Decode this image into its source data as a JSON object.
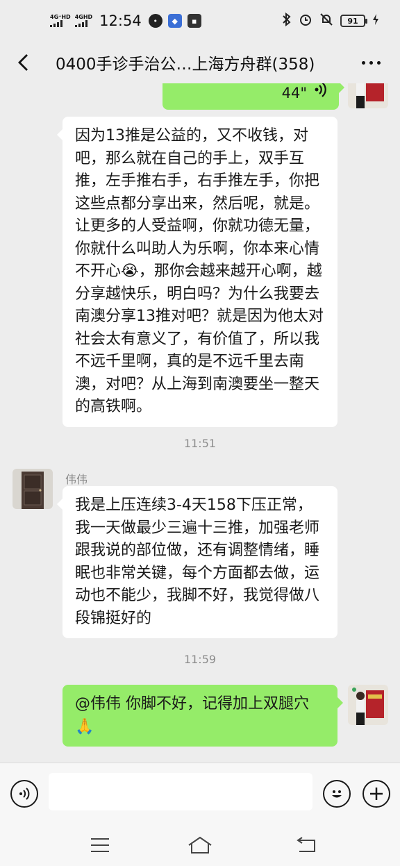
{
  "status": {
    "sig1": "4G⁺HD",
    "sig2": "4GHD",
    "time": "12:54",
    "battery": "91"
  },
  "header": {
    "title": "0400手诊手治公…上海方舟群(358)"
  },
  "messages": {
    "voice_duration": "44\"",
    "msg1_text": "因为13推是公益的，又不收钱，对吧，那么就在自己的手上，双手互推，左手推右手，右手推左手，你把这些点都分享出来，然后呢，就是。让更多的人受益啊，你就功德无量，你就什么叫助人为乐啊，你本来心情不开心😭，那你会越来越开心啊，越分享越快乐，明白吗？为什么我要去南澳分享13推对吧？就是因为他太对社会太有意义了，有价值了，所以我不远千里啊，真的是不远千里去南澳，对吧？从上海到南澳要坐一整天的高铁啊。",
    "time1": "11:51",
    "sender2": "伟伟",
    "msg2_text": "我是上压连续3-4天158下压正常，我一天做最少三遍十三推，加强老师跟我说的部位做，还有调整情绪，睡眠也非常关键，每个方面都去做，运动也不能少，我脚不好，我觉得做八段锦挺好的",
    "time2": "11:59",
    "msg3_text": "@伟伟  你脚不好，记得加上双腿穴🙏"
  },
  "icons": {
    "back": "back-arrow-icon",
    "more": "more-dots-icon",
    "voice": "voice-toggle-icon",
    "emoji": "emoji-icon",
    "plus": "plus-icon",
    "nav_menu": "menu-icon",
    "nav_home": "home-icon",
    "nav_back": "back-icon"
  },
  "colors": {
    "chat_bg": "#ededed",
    "bubble_self": "#95ec69",
    "bubble_other": "#ffffff"
  }
}
